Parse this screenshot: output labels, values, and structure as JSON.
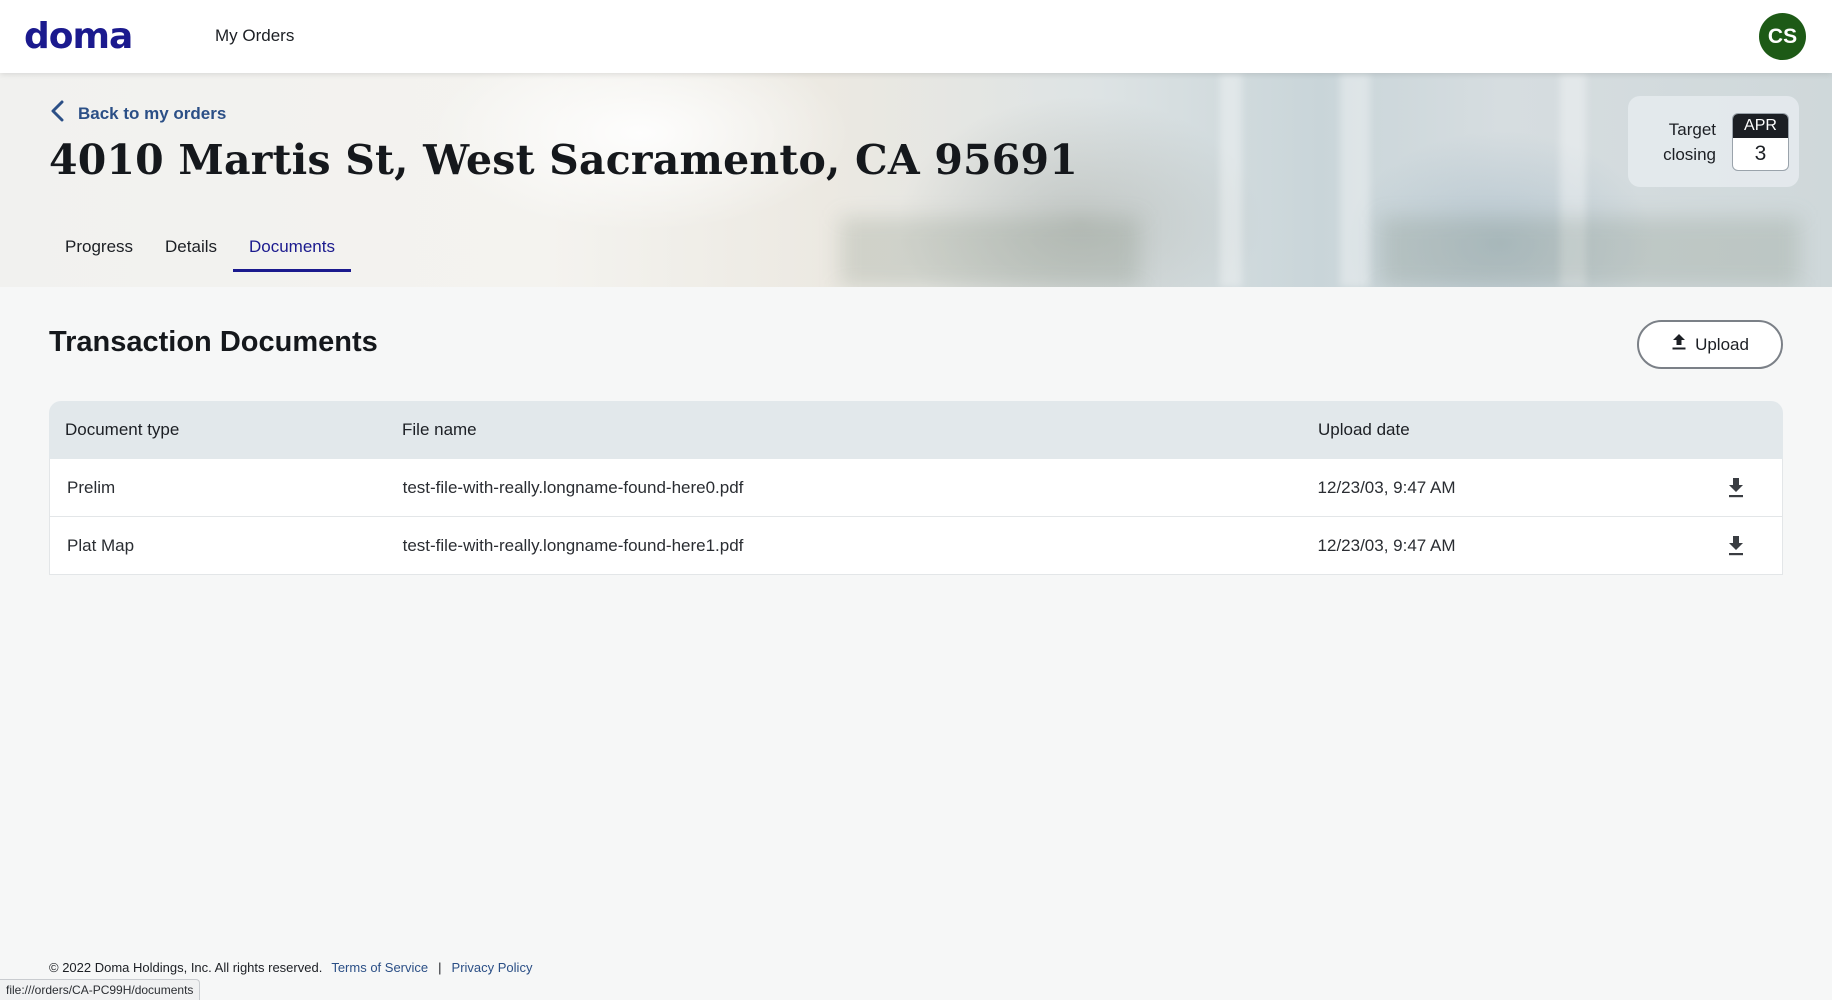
{
  "nav": {
    "logo_text": "doma",
    "my_orders": "My Orders",
    "avatar_initials": "CS",
    "avatar_color": "#1d5a16"
  },
  "hero": {
    "back_label": "Back to my orders",
    "address": "4010 Martis St, West Sacramento, CA 95691",
    "tabs": [
      {
        "label": "Progress",
        "active": false
      },
      {
        "label": "Details",
        "active": false
      },
      {
        "label": "Documents",
        "active": true
      }
    ],
    "closing": {
      "label_line1": "Target",
      "label_line2": "closing",
      "month": "APR",
      "day": "3"
    }
  },
  "documents": {
    "title": "Transaction Documents",
    "upload_label": "Upload",
    "columns": [
      "Document type",
      "File name",
      "Upload date"
    ],
    "rows": [
      {
        "type": "Prelim",
        "file": "test-file-with-really.longname-found-here0.pdf",
        "date": "12/23/03, 9:47 AM",
        "icon": "download-icon"
      },
      {
        "type": "Plat Map",
        "file": "test-file-with-really.longname-found-here1.pdf",
        "date": "12/23/03, 9:47 AM",
        "icon": "download-icon"
      }
    ]
  },
  "footer": {
    "copyright": "© 2022 Doma Holdings, Inc. All rights reserved.",
    "terms": "Terms of Service",
    "privacy": "Privacy Policy"
  },
  "status_bar": "file:///orders/CA-PC99H/documents",
  "colors": {
    "brand": "#1b1a8e",
    "link": "#2b4f86"
  }
}
